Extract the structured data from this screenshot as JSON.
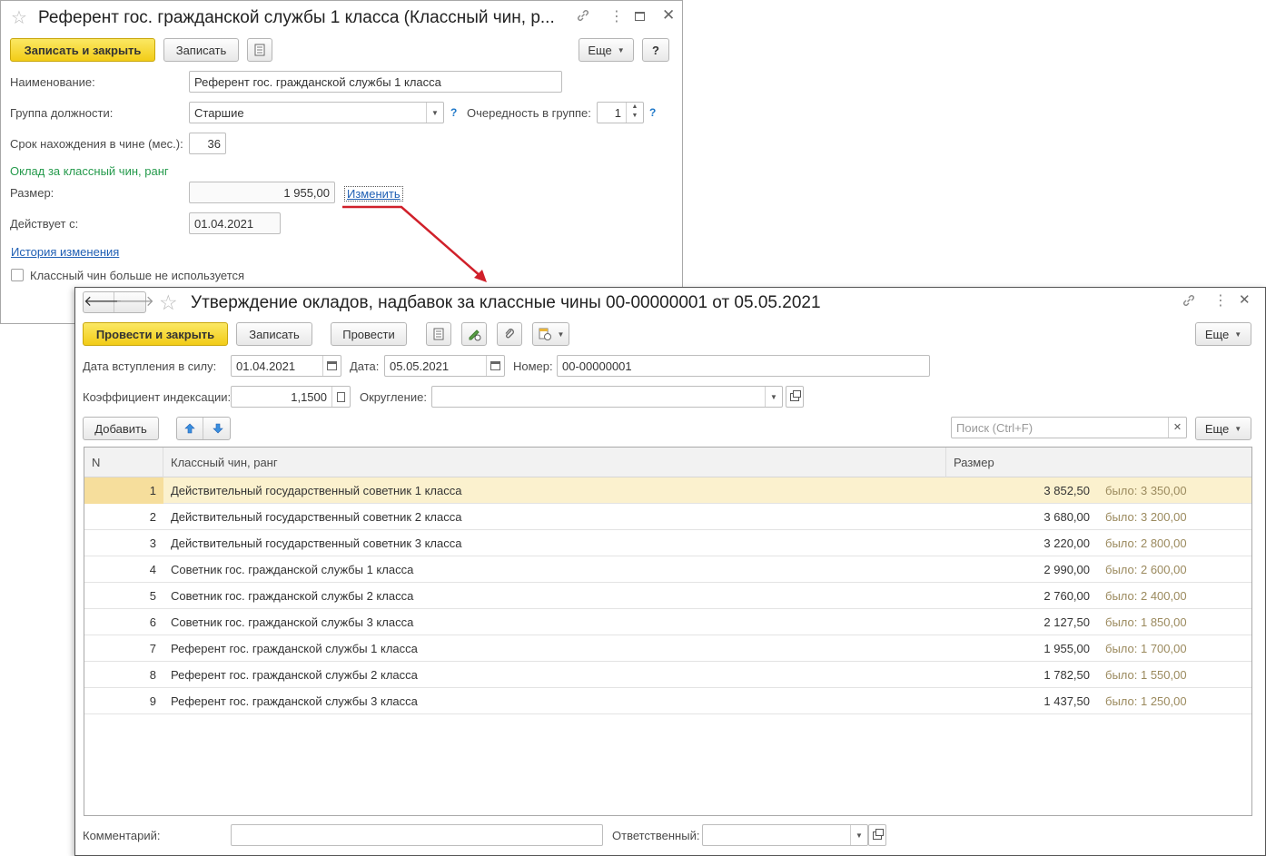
{
  "win1": {
    "title": "Референт гос. гражданской службы 1 класса (Классный чин, р...",
    "buttons": {
      "save_close": "Записать и закрыть",
      "save": "Записать",
      "more": "Еще",
      "help": "?"
    },
    "fields": {
      "name_label": "Наименование:",
      "name_value": "Референт гос. гражданской службы 1 класса",
      "group_label": "Группа должности:",
      "group_value": "Старшие",
      "group_help": "?",
      "order_label": "Очередность в группе:",
      "order_value": "1",
      "order_help": "?",
      "term_label": "Срок нахождения в чине (мес.):",
      "term_value": "36",
      "salary_section": "Оклад за классный чин, ранг",
      "size_label": "Размер:",
      "size_value": "1 955,00",
      "change_link": "Изменить",
      "valid_from_label": "Действует с:",
      "valid_from_value": "01.04.2021",
      "history_link": "История изменения",
      "unused_checkbox_label": "Классный чин больше не используется",
      "unused_checked": false
    }
  },
  "win2": {
    "title": "Утверждение окладов, надбавок за классные чины 00-00000001 от 05.05.2021",
    "buttons": {
      "post_close": "Провести и закрыть",
      "save": "Записать",
      "post": "Провести",
      "more": "Еще",
      "add": "Добавить",
      "more2": "Еще"
    },
    "fields": {
      "effective_date_label": "Дата вступления в силу:",
      "effective_date_value": "01.04.2021",
      "date_label": "Дата:",
      "date_value": "05.05.2021",
      "number_label": "Номер:",
      "number_value": "00-00000001",
      "index_coef_label": "Коэффициент индексации:",
      "index_coef_value": "1,1500",
      "rounding_label": "Округление:",
      "rounding_value": "",
      "search_placeholder": "Поиск (Ctrl+F)",
      "comment_label": "Комментарий:",
      "comment_value": "",
      "responsible_label": "Ответственный:",
      "responsible_value": ""
    },
    "table": {
      "headers": {
        "n": "N",
        "rank": "Классный чин, ранг",
        "size": "Размер"
      },
      "rows": [
        {
          "n": "1",
          "rank": "Действительный государственный советник 1 класса",
          "size": "3 852,50",
          "was": "было: 3 350,00"
        },
        {
          "n": "2",
          "rank": "Действительный государственный советник 2 класса",
          "size": "3 680,00",
          "was": "было: 3 200,00"
        },
        {
          "n": "3",
          "rank": "Действительный государственный советник 3 класса",
          "size": "3 220,00",
          "was": "было: 2 800,00"
        },
        {
          "n": "4",
          "rank": "Советник гос. гражданской службы 1 класса",
          "size": "2 990,00",
          "was": "было: 2 600,00"
        },
        {
          "n": "5",
          "rank": "Советник гос. гражданской службы 2 класса",
          "size": "2 760,00",
          "was": "было: 2 400,00"
        },
        {
          "n": "6",
          "rank": "Советник гос. гражданской службы 3 класса",
          "size": "2 127,50",
          "was": "было: 1 850,00"
        },
        {
          "n": "7",
          "rank": "Референт гос. гражданской службы 1 класса",
          "size": "1 955,00",
          "was": "было: 1 700,00"
        },
        {
          "n": "8",
          "rank": "Референт гос. гражданской службы 2 класса",
          "size": "1 782,50",
          "was": "было: 1 550,00"
        },
        {
          "n": "9",
          "rank": "Референт гос. гражданской службы 3 класса",
          "size": "1 437,50",
          "was": "было: 1 250,00"
        }
      ]
    }
  },
  "colors": {
    "primary_button": "#f2cc17",
    "link": "#1f5fb4",
    "section_green": "#259a4c",
    "selected_row": "#fbf1ce",
    "arrow": "#d0202a"
  }
}
